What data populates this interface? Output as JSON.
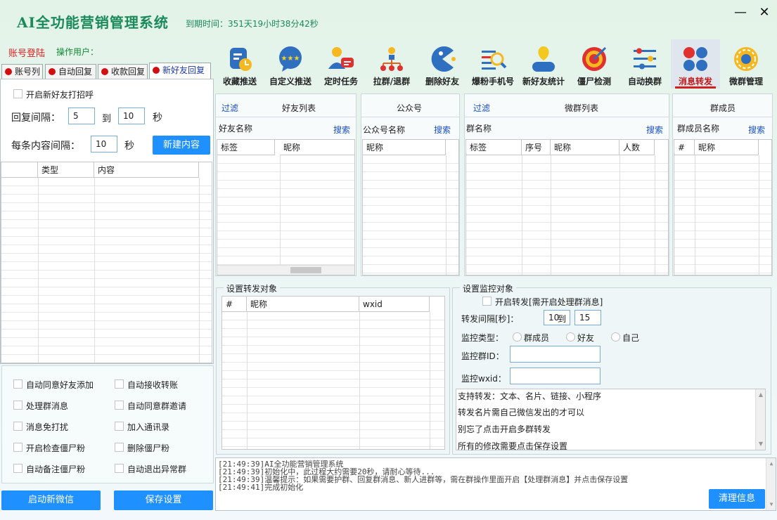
{
  "app": {
    "title": "AI全功能营销管理系统",
    "expire": "到期时间：351天19小时38分42秒",
    "minimize": "—",
    "close": "✕"
  },
  "account": {
    "login_status": "账号登陆",
    "operator_label": "操作用户："
  },
  "toolbar": [
    {
      "label": "收藏推送",
      "icon": "favorite-push-icon"
    },
    {
      "label": "自定义推送",
      "icon": "custom-push-icon"
    },
    {
      "label": "定时任务",
      "icon": "scheduled-task-icon"
    },
    {
      "label": "拉群/退群",
      "icon": "group-join-icon"
    },
    {
      "label": "删除好友",
      "icon": "delete-friend-icon"
    },
    {
      "label": "爆粉手机号",
      "icon": "phone-search-icon"
    },
    {
      "label": "新好友统计",
      "icon": "new-friend-stats-icon"
    },
    {
      "label": "僵尸检测",
      "icon": "zombie-detect-icon"
    },
    {
      "label": "自动换群",
      "icon": "auto-switch-group-icon"
    },
    {
      "label": "消息转发",
      "icon": "message-forward-icon",
      "active": true
    },
    {
      "label": "微群管理",
      "icon": "group-manage-icon"
    }
  ],
  "tabs": [
    "账号列",
    "自动回复",
    "收款回复",
    "新好友回复"
  ],
  "new_friend": {
    "enable_greeting": "开启新好友打招呼",
    "reply_interval_label": "回复间隔：",
    "interval_from": "5",
    "to": "到",
    "interval_to": "10",
    "seconds": "秒",
    "content_interval_label": "每条内容间隔：",
    "content_interval": "10",
    "new_content_button": "新建内容",
    "columns": [
      "",
      "类型",
      "内容"
    ]
  },
  "options": [
    "自动同意好友添加",
    "自动接收转账",
    "处理群消息",
    "自动同意群邀请",
    "消息免打扰",
    "加入通讯录",
    "开启检查僵尸粉",
    "删除僵尸粉",
    "自动备注僵尸粉",
    "自动退出异常群"
  ],
  "buttons": {
    "start_wechat": "启动新微信",
    "save_settings": "保存设置",
    "clear_info": "清理信息"
  },
  "friends": {
    "filter": "过滤",
    "title": "好友列表",
    "name_label": "好友名称",
    "search": "搜索",
    "columns": [
      "标签",
      "昵称"
    ]
  },
  "official": {
    "title": "公众号",
    "name_label": "公众号名称",
    "search": "搜索",
    "columns": [
      "昵称"
    ]
  },
  "groups": {
    "filter": "过滤",
    "title": "微群列表",
    "name_label": "群名称",
    "search": "搜索",
    "columns": [
      "标签",
      "序号",
      "昵称",
      "人数"
    ]
  },
  "members": {
    "title": "群成员",
    "name_label": "群成员名称",
    "search": "搜索",
    "columns": [
      "#",
      "昵称"
    ]
  },
  "forward_target": {
    "title": "设置转发对象",
    "columns": [
      "#",
      "昵称",
      "wxid"
    ]
  },
  "monitor": {
    "title": "设置监控对象",
    "enable_forward": "开启转发[需开启处理群消息]",
    "interval_label": "转发间隔[秒]：",
    "interval_from": "10",
    "to": "到",
    "interval_to": "15",
    "type_label": "监控类型：",
    "types": [
      "群成员",
      "好友",
      "自己"
    ],
    "group_id_label": "监控群ID：",
    "wxid_label": "监控wxid：",
    "info_lines": [
      "支持转发：文本、名片、链接、小程序",
      "转发名片需自己微信发出的才可以",
      "别忘了点击开启多群转发",
      "所有的修改需要点击保存设置"
    ]
  },
  "log": [
    "[21:49:39]AI全功能营销管理系统",
    "[21:49:39]初始化中，此过程大约需要20秒，请耐心等待...",
    "[21:49:39]温馨提示：如果需要护群、回复群消息、新人进群等，需在群操作里面开启【处理群消息】并点击保存设置",
    "[21:49:41]完成初始化"
  ]
}
